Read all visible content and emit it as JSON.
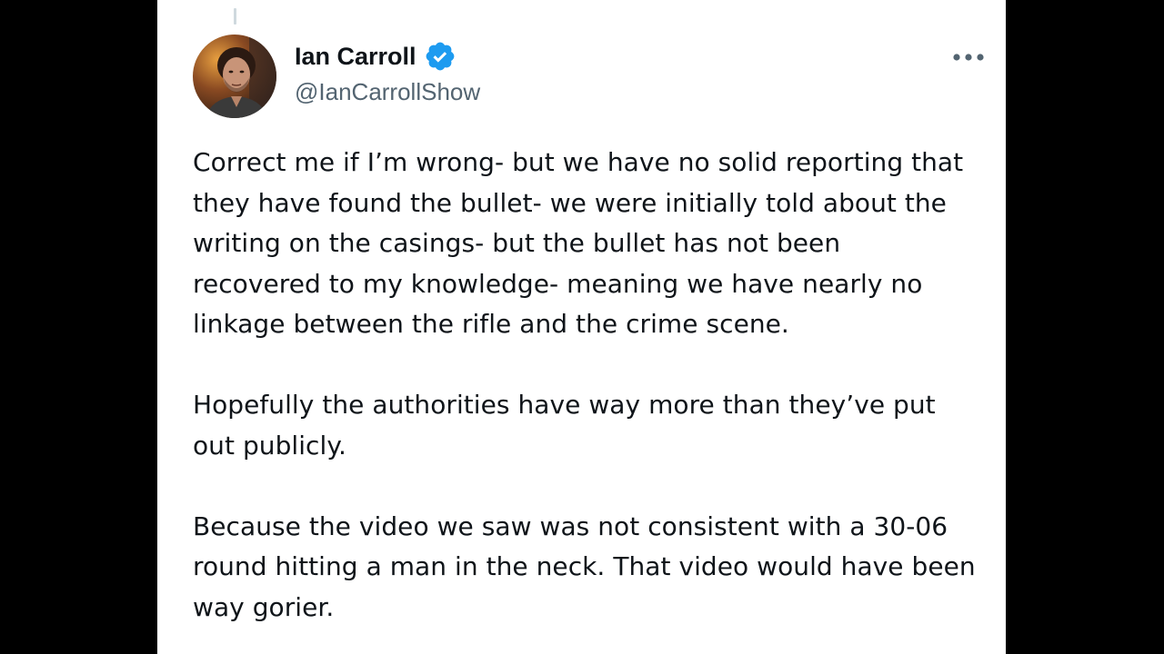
{
  "post": {
    "author": {
      "display_name": "Ian Carroll",
      "handle": "@IanCarrollShow",
      "verified_icon": "verified-badge-icon",
      "avatar_icon": "avatar-photo"
    },
    "more_icon": "more-options-icon",
    "paragraphs": [
      {
        "lines": [
          "Correct me if I’m wrong- but we have no solid reporting that",
          "they have found the bullet- we were initially told about the",
          "writing on the casings- but the bullet has not been",
          "recovered to my knowledge- meaning we have nearly no",
          "linkage between the rifle and the crime scene."
        ]
      },
      {
        "lines": [
          "Hopefully the authorities have way more than they’ve put",
          "out publicly."
        ]
      },
      {
        "lines": [
          "Because the video we saw was not consistent with a 30-06",
          "round hitting a man in the neck. That video would have been",
          "way gorier."
        ]
      }
    ]
  },
  "colors": {
    "page_background": "#000000",
    "card_background": "#ffffff",
    "text_primary": "#0f1419",
    "text_secondary": "#536471",
    "verified_blue": "#1d9bf0"
  }
}
